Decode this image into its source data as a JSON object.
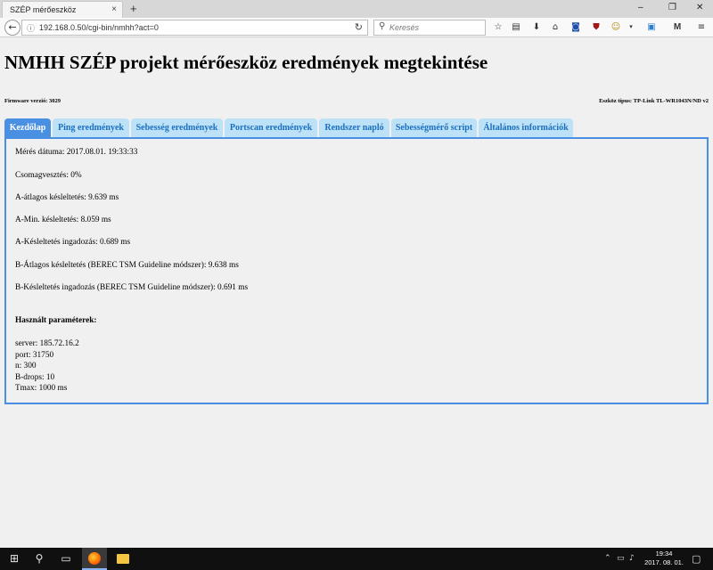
{
  "browser": {
    "tab_title": "SZÉP mérőeszköz",
    "tab_close": "×",
    "new_tab": "+",
    "window_controls": [
      "–",
      "❐",
      "✕"
    ],
    "url": "192.168.0.50/cgi-bin/nmhh?act=0",
    "search_placeholder": "Keresés",
    "icons": {
      "back": "back-arrow-icon",
      "info": "info-icon",
      "reload": "reload-icon",
      "search": "search-icon",
      "toolbar": [
        "star-icon",
        "reading-list-icon",
        "download-icon",
        "home-icon",
        "pocket-icon",
        "ublock-icon",
        "extension-icon",
        "dropdown-icon",
        "screenshot-icon",
        "gmail-icon",
        "menu-icon"
      ]
    }
  },
  "page": {
    "title": "NMHH SZÉP projekt mérőeszköz eredmények megtekintése",
    "firmware": "Firmware verzió: 3029",
    "device": "Eszköz típus: TP-Link TL-WR1043N/ND v2",
    "tabs": [
      {
        "label": "Kezdőlap",
        "active": true
      },
      {
        "label": "Ping eredmények",
        "active": false
      },
      {
        "label": "Sebesség eredmények",
        "active": false
      },
      {
        "label": "Portscan eredmények",
        "active": false
      },
      {
        "label": "Rendszer napló",
        "active": false
      },
      {
        "label": "Sebességmérő script",
        "active": false
      },
      {
        "label": "Általános információk",
        "active": false
      }
    ],
    "results": [
      "Mérés dátuma: 2017.08.01. 19:33:33",
      "Csomagvesztés: 0%",
      "A-átlagos késleltetés: 9.639 ms",
      "A-Min. késleltetés: 8.059 ms",
      "A-Késleltetés ingadozás: 0.689 ms",
      "B-Átlagos késleltetés (BEREC TSM Guideline módszer): 9.638 ms",
      "B-Késleltetés ingadozás (BEREC TSM Guideline módszer): 0.691 ms"
    ],
    "params_heading": "Használt paraméterek:",
    "params": [
      "server: 185.72.16.2",
      "port: 31750",
      "n: 300",
      "B-drops: 10",
      "Tmax: 1000 ms"
    ]
  },
  "taskbar": {
    "time": "19:34",
    "date": "2017. 08. 01.",
    "icons": [
      "windows-start-icon",
      "search-icon",
      "task-view-icon",
      "firefox-icon",
      "file-explorer-icon"
    ],
    "tray_icons": [
      "chevron-up-icon",
      "network-icon",
      "volume-icon",
      "notification-icon"
    ]
  },
  "colors": {
    "accent": "#4a90e2",
    "tab_inactive_bg": "#bde2f8",
    "tab_inactive_text": "#1a6fc0"
  }
}
